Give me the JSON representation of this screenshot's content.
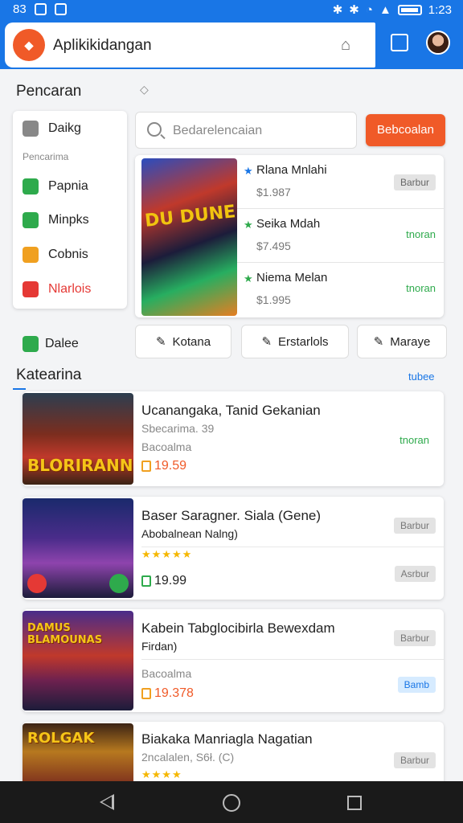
{
  "status": {
    "left_text": "83",
    "time": "1:23"
  },
  "app": {
    "name": "Aplikikidangan"
  },
  "pencarian": {
    "title": "Pencaran"
  },
  "sidebar": {
    "items": [
      {
        "label": "Daikg",
        "color": "#888888"
      },
      {
        "label": "Papnia",
        "color": "#2eaa4c"
      },
      {
        "label": "Minpks",
        "color": "#2eaa4c"
      },
      {
        "label": "Cobnis",
        "color": "#f0a020"
      },
      {
        "label": "Nlarlois",
        "color": "#e53935"
      }
    ],
    "subheader": "Pencarima"
  },
  "search": {
    "placeholder": "Bedarelencaian",
    "button_label": "Bebcoalan"
  },
  "featured": {
    "image_text": "DU DUNE",
    "rows": [
      {
        "name": "Rlana Mnlahi",
        "price": "$1.987",
        "tag": "Barbur",
        "tag_type": "gray",
        "star_color": "#1976e6"
      },
      {
        "name": "Seika Mdah",
        "price": "$7.495",
        "tag": "tnoran",
        "tag_type": "green",
        "star_color": "#2eaa4c"
      },
      {
        "name": "Niema Melan",
        "price": "$1.995",
        "tag": "tnoran",
        "tag_type": "green",
        "star_color": "#2eaa4c"
      }
    ]
  },
  "chips": [
    {
      "label": "Kotana"
    },
    {
      "label": "Erstarlols"
    },
    {
      "label": "Maraye"
    }
  ],
  "dalee": {
    "label": "Dalee"
  },
  "kategori": {
    "title": "Katearina",
    "link": "tubee"
  },
  "cards": [
    {
      "image_word": "BLORIRANN",
      "title": "Ucanangaka, Tanid Gekanian",
      "subtitle": "Sbecarima. 39",
      "subtitle_color": "#888888",
      "developer": "Bacoalma",
      "price": "19.59",
      "tags": [
        {
          "label": "tnoran",
          "type": "green"
        }
      ]
    },
    {
      "image_word": "",
      "title": "Baser Saragner. Siala (Gene)",
      "subtitle": "Abobalnean Nalng)",
      "subtitle_color": "#2eaa4c",
      "stars": "★★★★★",
      "price": "19.99",
      "tags": [
        {
          "label": "Barbur",
          "type": "gray"
        },
        {
          "label": "Asrbur",
          "type": "gray"
        }
      ]
    },
    {
      "image_word": "DAMUS BLAMOUNAS",
      "title": "Kabein Tabglocibirla Bewexdam",
      "subtitle": "Firdan)",
      "subtitle_color": "#2eaa4c",
      "developer": "Bacoalma",
      "price": "19.378",
      "tags": [
        {
          "label": "Barbur",
          "type": "gray"
        },
        {
          "label": "Bamb",
          "type": "blue"
        }
      ]
    },
    {
      "image_word": "ROLGAK",
      "title": "Biakaka Manriagla Nagatian",
      "subtitle": "2ncalalen, S6ł. (C)",
      "subtitle_color": "#888888",
      "stars": "★★★★",
      "tags": [
        {
          "label": "Barbur",
          "type": "gray"
        }
      ]
    }
  ]
}
